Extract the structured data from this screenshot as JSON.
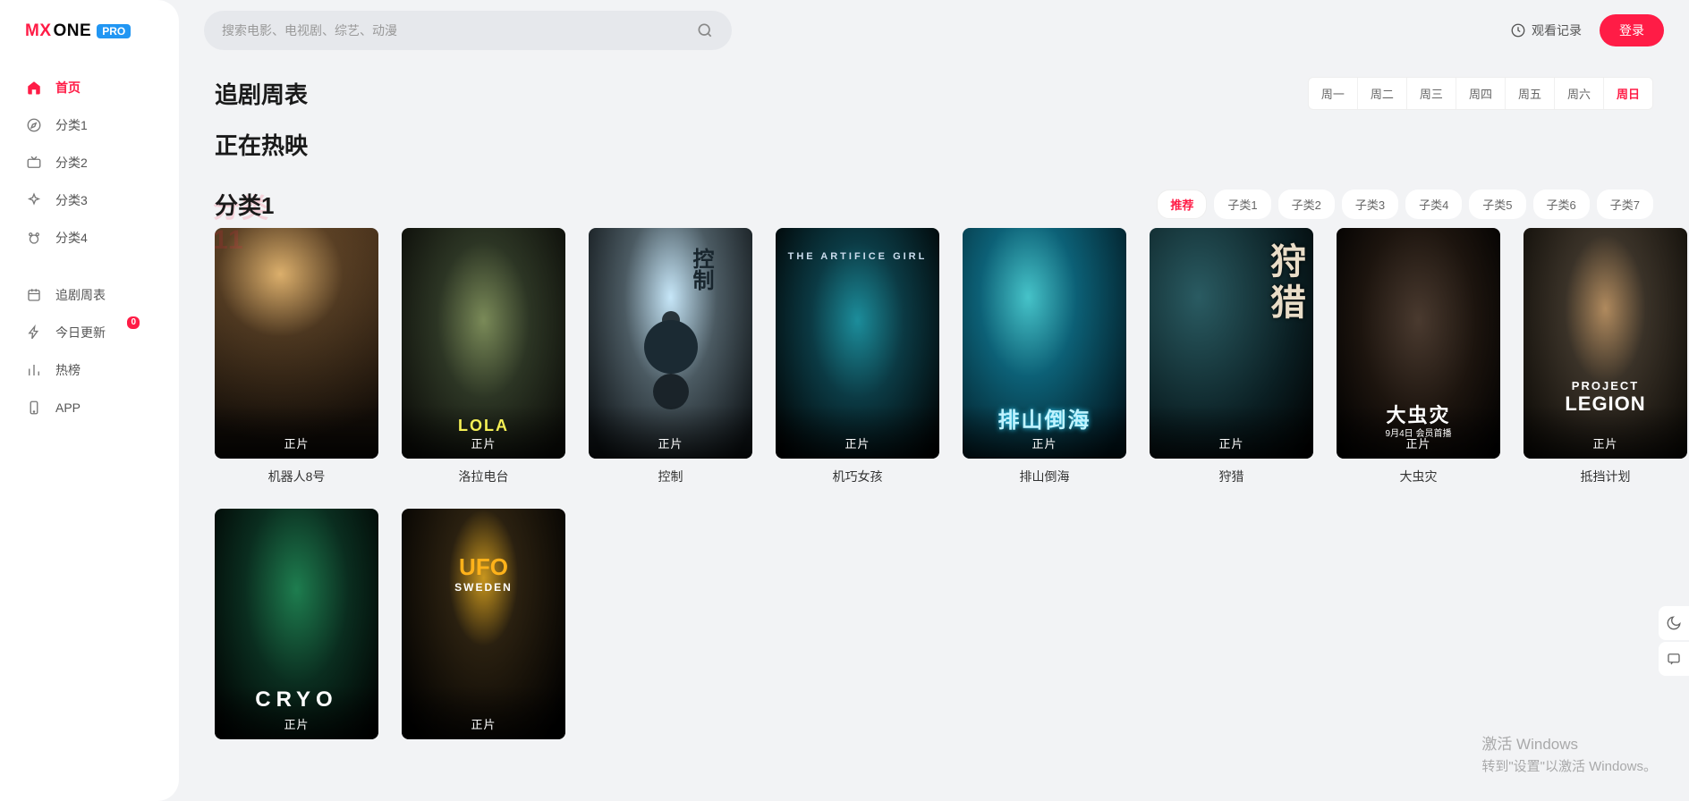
{
  "logo": {
    "part1": "MX",
    "part2": "ONE",
    "badge": "PRO"
  },
  "sidebar": {
    "primary": [
      {
        "label": "首页",
        "icon": "home",
        "active": true
      },
      {
        "label": "分类1",
        "icon": "compass"
      },
      {
        "label": "分类2",
        "icon": "tv"
      },
      {
        "label": "分类3",
        "icon": "sparkle"
      },
      {
        "label": "分类4",
        "icon": "bear"
      }
    ],
    "secondary": [
      {
        "label": "追剧周表",
        "icon": "calendar"
      },
      {
        "label": "今日更新",
        "icon": "bolt",
        "badge": "0"
      },
      {
        "label": "热榜",
        "icon": "chart"
      },
      {
        "label": "APP",
        "icon": "phone"
      }
    ]
  },
  "search": {
    "placeholder": "搜索电影、电视剧、综艺、动漫"
  },
  "header": {
    "history": "观看记录",
    "login": "登录"
  },
  "sections": {
    "schedule": {
      "title": "追剧周表",
      "days": [
        "周一",
        "周二",
        "周三",
        "周四",
        "周五",
        "周六",
        "周日"
      ],
      "active_day": "周日"
    },
    "hot": {
      "title": "正在热映"
    },
    "cat1": {
      "title": "分类1",
      "ghost": "分类11",
      "tabs": [
        "推荐",
        "子类1",
        "子类2",
        "子类3",
        "子类4",
        "子类5",
        "子类6",
        "子类7"
      ],
      "active_tab": "推荐",
      "items": [
        {
          "title": "机器人8号",
          "tag": "正片",
          "overlay": "",
          "poster_class": "p1"
        },
        {
          "title": "洛拉电台",
          "tag": "正片",
          "overlay": "LOLA",
          "poster_class": "p2"
        },
        {
          "title": "控制",
          "tag": "正片",
          "overlay": "控制",
          "poster_class": "p3"
        },
        {
          "title": "机巧女孩",
          "tag": "正片",
          "overlay": "THE ARTIFICE GIRL",
          "poster_class": "p4"
        },
        {
          "title": "排山倒海",
          "tag": "正片",
          "overlay": "排山倒海",
          "poster_class": "p5"
        },
        {
          "title": "狩猎",
          "tag": "正片",
          "overlay": "狩猎",
          "poster_class": "p6"
        },
        {
          "title": "大虫灾",
          "tag": "正片",
          "overlay": "大虫灾",
          "sub": "9月4日 会员首播",
          "poster_class": "p7"
        },
        {
          "title": "抵挡计划",
          "tag": "正片",
          "overlay": "LEGION",
          "overlay_pre": "PROJECT",
          "poster_class": "p8"
        },
        {
          "title": "",
          "tag": "正片",
          "overlay": "CRYO",
          "poster_class": "p9"
        },
        {
          "title": "",
          "tag": "正片",
          "overlay": "UFO",
          "overlay_sub": "SWEDEN",
          "poster_class": "p10"
        }
      ]
    }
  },
  "watermark": {
    "line1": "激活 Windows",
    "line2": "转到\"设置\"以激活 Windows。"
  }
}
